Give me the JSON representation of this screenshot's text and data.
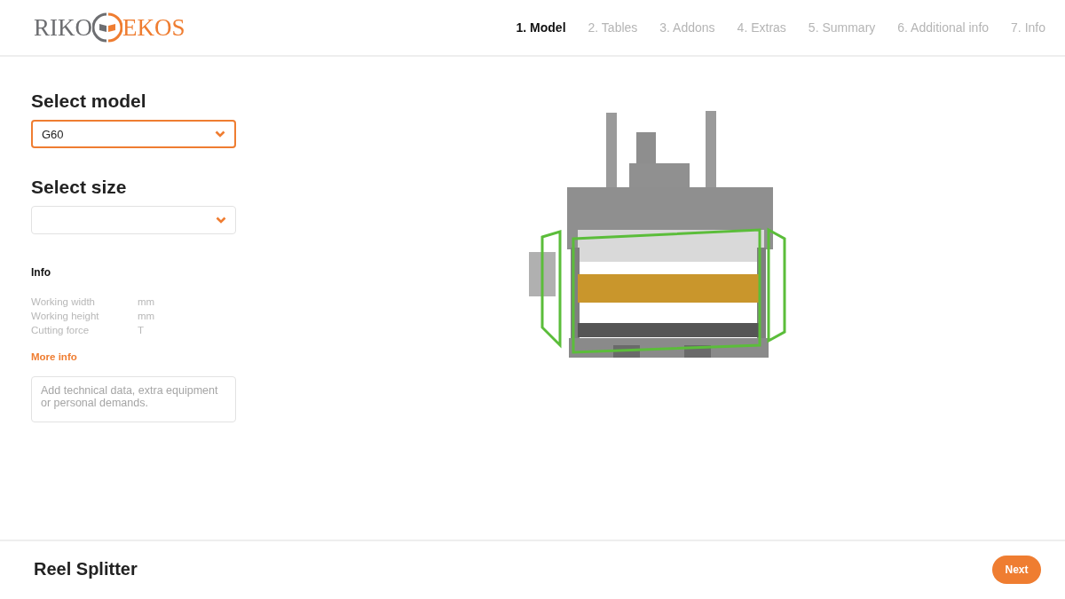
{
  "logo": {
    "left_text": "RIKO",
    "right_text": "EKOS"
  },
  "steps": [
    {
      "label": "1. Model",
      "selected": true
    },
    {
      "label": "2. Tables",
      "selected": false
    },
    {
      "label": "3. Addons",
      "selected": false
    },
    {
      "label": "4. Extras",
      "selected": false
    },
    {
      "label": "5. Summary",
      "selected": false
    },
    {
      "label": "6. Additional info",
      "selected": false
    },
    {
      "label": "7. Info",
      "selected": false
    }
  ],
  "model_select": {
    "label": "Select model",
    "value": "G60",
    "focused": true
  },
  "size_select": {
    "label": "Select size",
    "focused": false
  },
  "info": {
    "title": "Info",
    "rows": [
      {
        "label": "Working width",
        "unit": "mm"
      },
      {
        "label": "Working height",
        "unit": "mm"
      },
      {
        "label": "Cutting force",
        "unit": "T"
      }
    ],
    "link": "More info"
  },
  "notes": {
    "placeholder": "Add technical data, extra equipment or personal demands."
  },
  "footer": {
    "title": "Reel Splitter",
    "button": "Next"
  }
}
